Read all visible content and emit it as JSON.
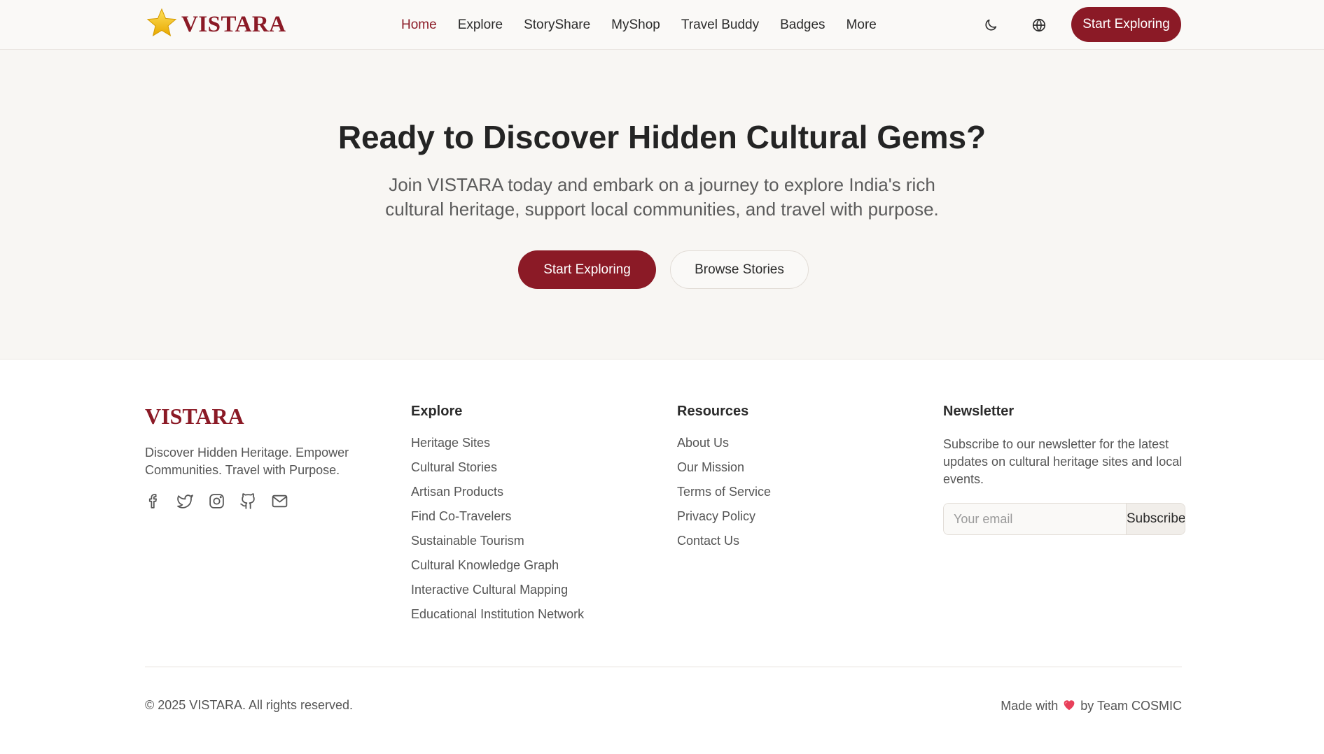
{
  "header": {
    "logo_text": "VISTARA",
    "nav": [
      {
        "label": "Home",
        "active": true
      },
      {
        "label": "Explore",
        "active": false
      },
      {
        "label": "StoryShare",
        "active": false
      },
      {
        "label": "MyShop",
        "active": false
      },
      {
        "label": "Travel Buddy",
        "active": false
      },
      {
        "label": "Badges",
        "active": false
      },
      {
        "label": "More",
        "active": false
      }
    ],
    "icons": [
      "moon-icon",
      "globe-icon"
    ],
    "cta_label": "Start Exploring"
  },
  "hero": {
    "title": "Ready to Discover Hidden Cultural Gems?",
    "subtitle": "Join VISTARA today and embark on a journey to explore India's rich cultural heritage, support local communities, and travel with purpose.",
    "primary_label": "Start Exploring",
    "secondary_label": "Browse Stories"
  },
  "footer": {
    "brand": "VISTARA",
    "tagline": "Discover Hidden Heritage. Empower Communities. Travel with Purpose.",
    "socials": [
      "facebook-icon",
      "twitter-icon",
      "instagram-icon",
      "github-icon",
      "mail-icon"
    ],
    "explore": {
      "heading": "Explore",
      "links": [
        "Heritage Sites",
        "Cultural Stories",
        "Artisan Products",
        "Find Co-Travelers",
        "Sustainable Tourism",
        "Cultural Knowledge Graph",
        "Interactive Cultural Mapping",
        "Educational Institution Network"
      ]
    },
    "resources": {
      "heading": "Resources",
      "links": [
        "About Us",
        "Our Mission",
        "Terms of Service",
        "Privacy Policy",
        "Contact Us"
      ]
    },
    "newsletter": {
      "heading": "Newsletter",
      "text": "Subscribe to our newsletter for the latest updates on cultural heritage sites and local events.",
      "email_value": "",
      "email_placeholder": "Your email",
      "subscribe_label": "Subscribe"
    },
    "copyright": "© 2025 VISTARA. All rights reserved.",
    "made_with_prefix": "Made with",
    "made_with_suffix": "by Team COSMIC"
  },
  "colors": {
    "brand": "#8b1a26",
    "hero_bg": "#f8f6f3",
    "star": "#f5c518",
    "heart": "#e8405a"
  }
}
